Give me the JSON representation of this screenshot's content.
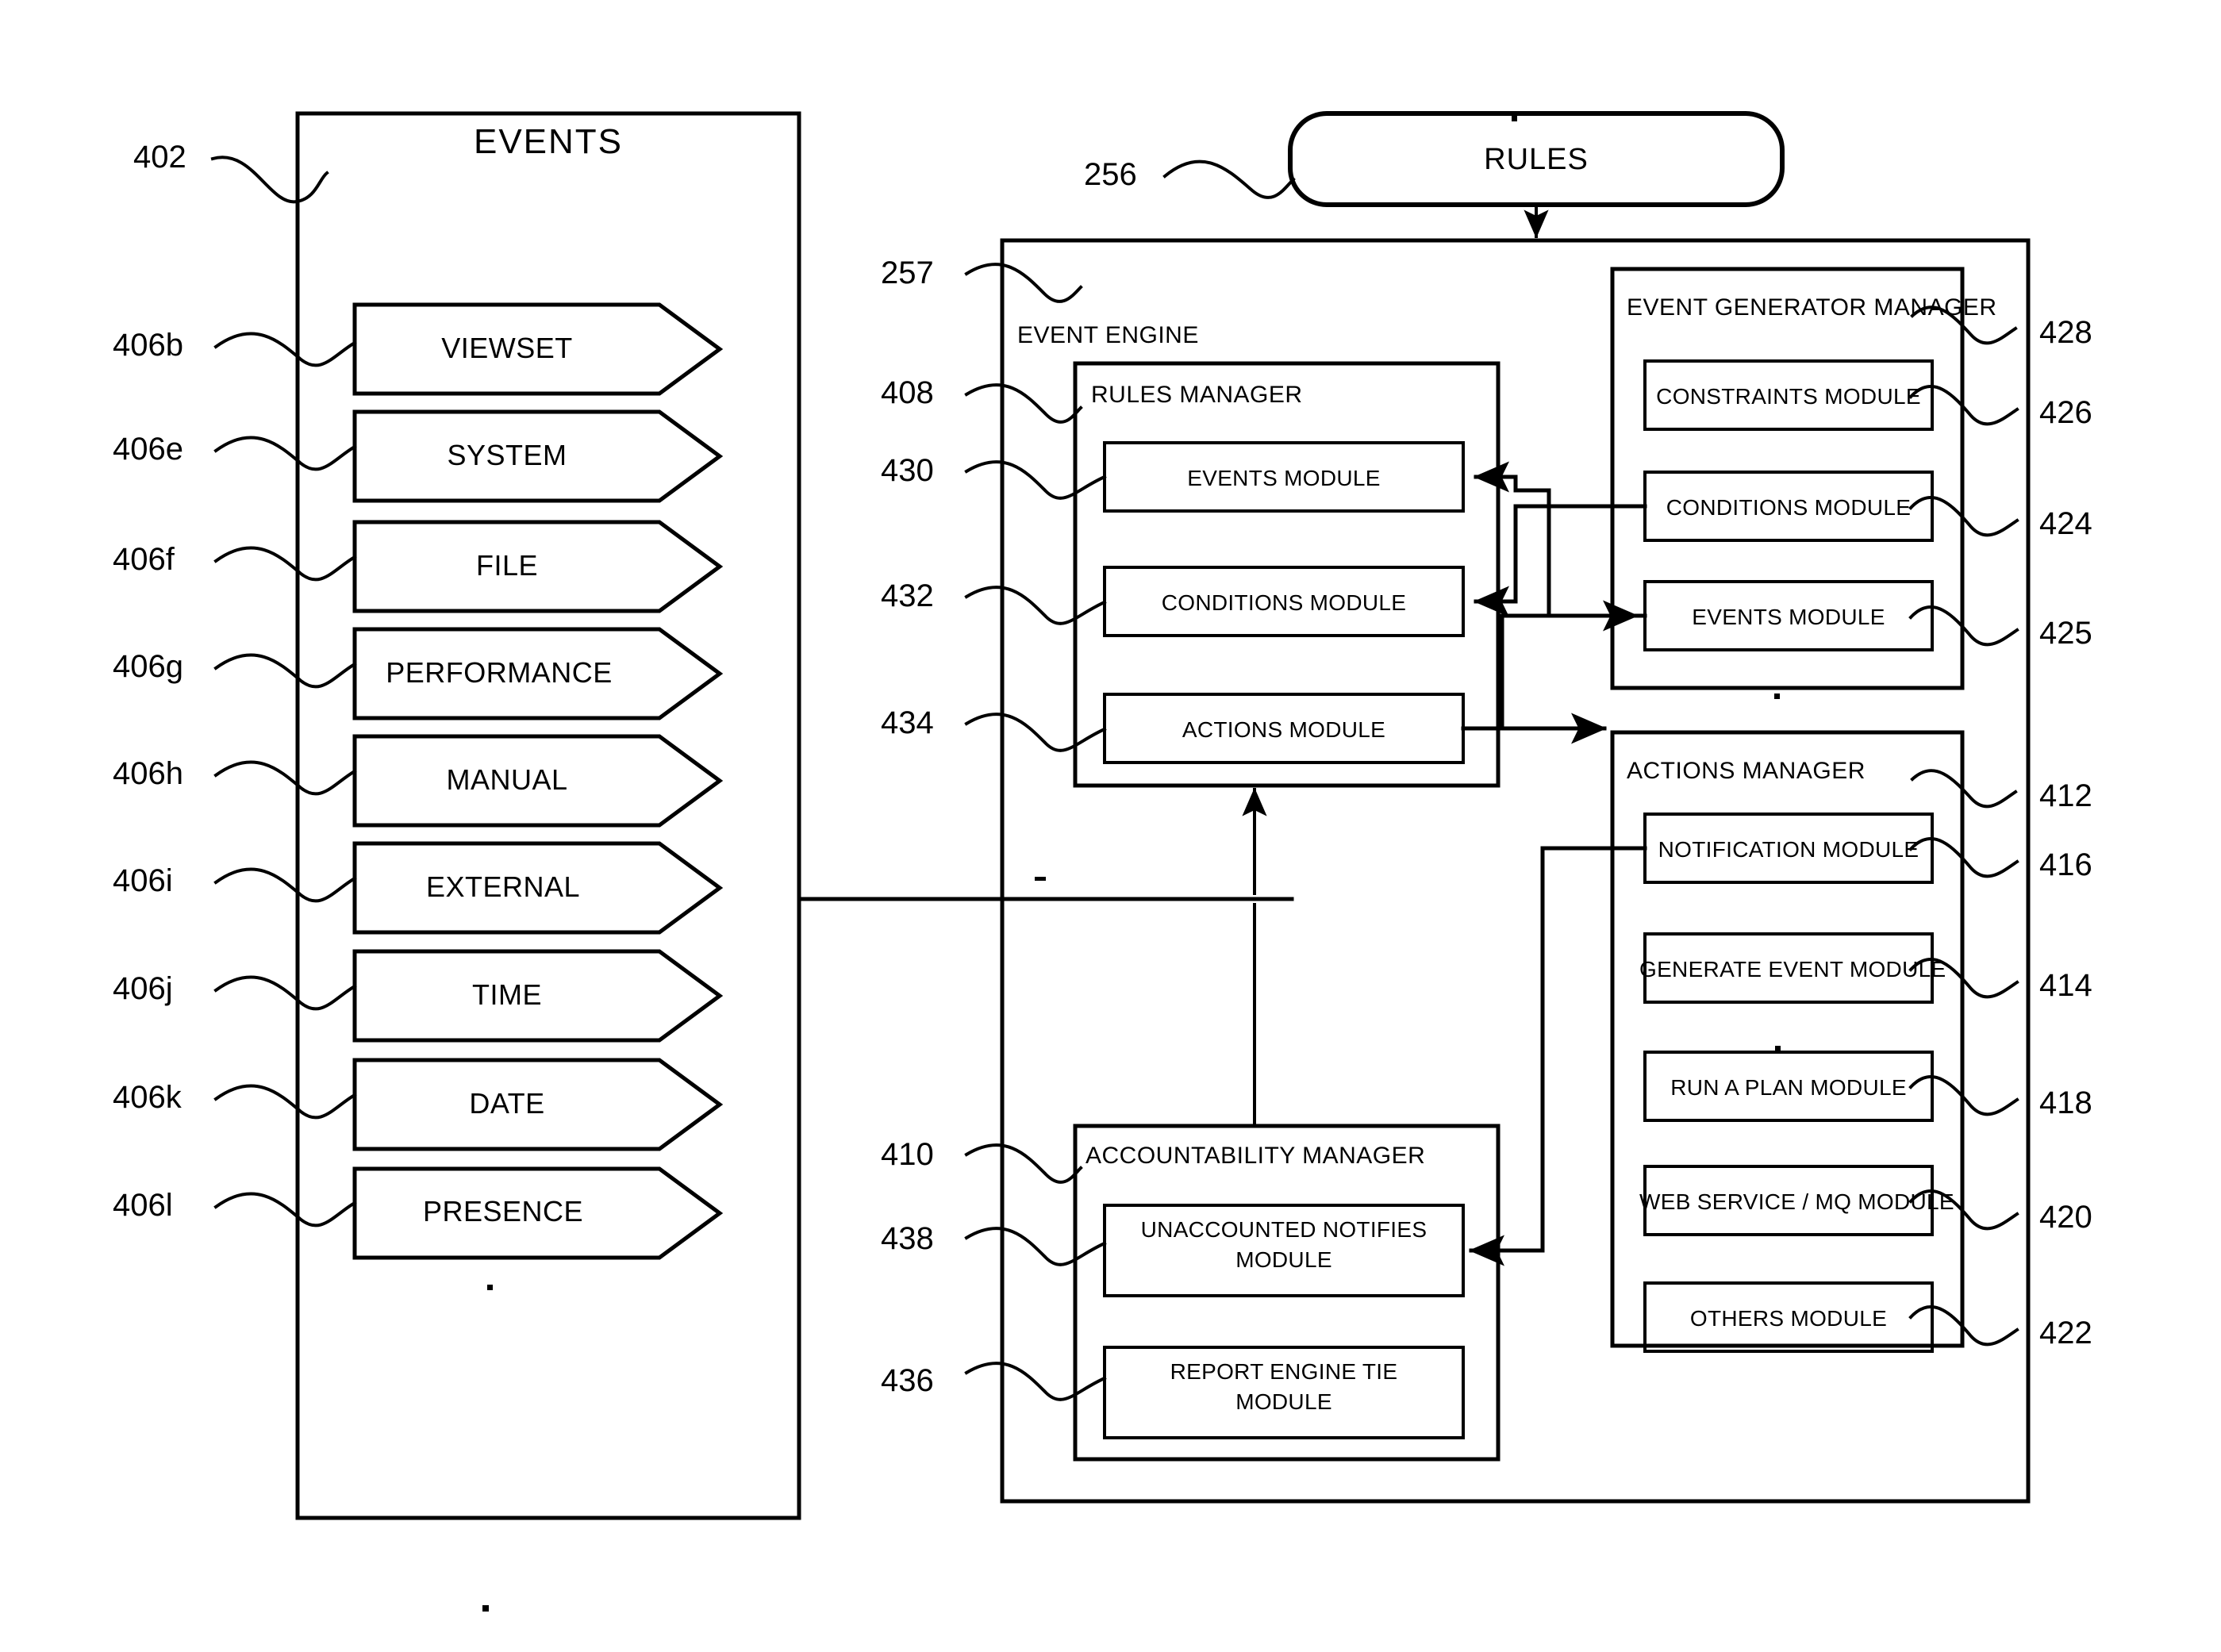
{
  "figure": {
    "left_panel": {
      "ref": "402",
      "title": "EVENTS",
      "items": [
        {
          "ref": "406b",
          "label": "VIEWSET"
        },
        {
          "ref": "406e",
          "label": "SYSTEM"
        },
        {
          "ref": "406f",
          "label": "FILE"
        },
        {
          "ref": "406g",
          "label": "PERFORMANCE"
        },
        {
          "ref": "406h",
          "label": "MANUAL"
        },
        {
          "ref": "406i",
          "label": "EXTERNAL"
        },
        {
          "ref": "406j",
          "label": "TIME"
        },
        {
          "ref": "406k",
          "label": "DATE"
        },
        {
          "ref": "406l",
          "label": "PRESENCE"
        }
      ]
    },
    "rules_box": {
      "ref": "256",
      "label": "RULES"
    },
    "event_engine": {
      "ref": "257",
      "label": "EVENT ENGINE",
      "rules_manager": {
        "ref": "408",
        "label": "RULES MANAGER",
        "modules": [
          {
            "ref": "430",
            "label": "EVENTS MODULE"
          },
          {
            "ref": "432",
            "label": "CONDITIONS MODULE"
          },
          {
            "ref": "434",
            "label": "ACTIONS MODULE"
          }
        ]
      },
      "event_generator_manager": {
        "ref": "428",
        "label": "EVENT GENERATOR MANAGER",
        "modules": [
          {
            "ref": "426",
            "label": "CONSTRAINTS MODULE"
          },
          {
            "ref": "424",
            "label": "CONDITIONS MODULE"
          },
          {
            "ref": "425",
            "label": "EVENTS MODULE"
          }
        ]
      },
      "actions_manager": {
        "ref": "412",
        "label": "ACTIONS MANAGER",
        "modules": [
          {
            "ref": "416",
            "label": "NOTIFICATION MODULE"
          },
          {
            "ref": "414",
            "label": "GENERATE EVENT MODULE"
          },
          {
            "ref": "418",
            "label": "RUN A PLAN MODULE"
          },
          {
            "ref": "420",
            "label": "WEB SERVICE / MQ MODULE"
          },
          {
            "ref": "422",
            "label": "OTHERS MODULE"
          }
        ]
      },
      "accountability_manager": {
        "ref": "410",
        "label": "ACCOUNTABILITY MANAGER",
        "modules": [
          {
            "ref": "438",
            "label_line1": "UNACCOUNTED NOTIFIES",
            "label_line2": "MODULE"
          },
          {
            "ref": "436",
            "label_line1": "REPORT ENGINE TIE",
            "label_line2": "MODULE"
          }
        ]
      }
    }
  },
  "colors": {
    "ink": "#000000",
    "paper": "#ffffff"
  }
}
